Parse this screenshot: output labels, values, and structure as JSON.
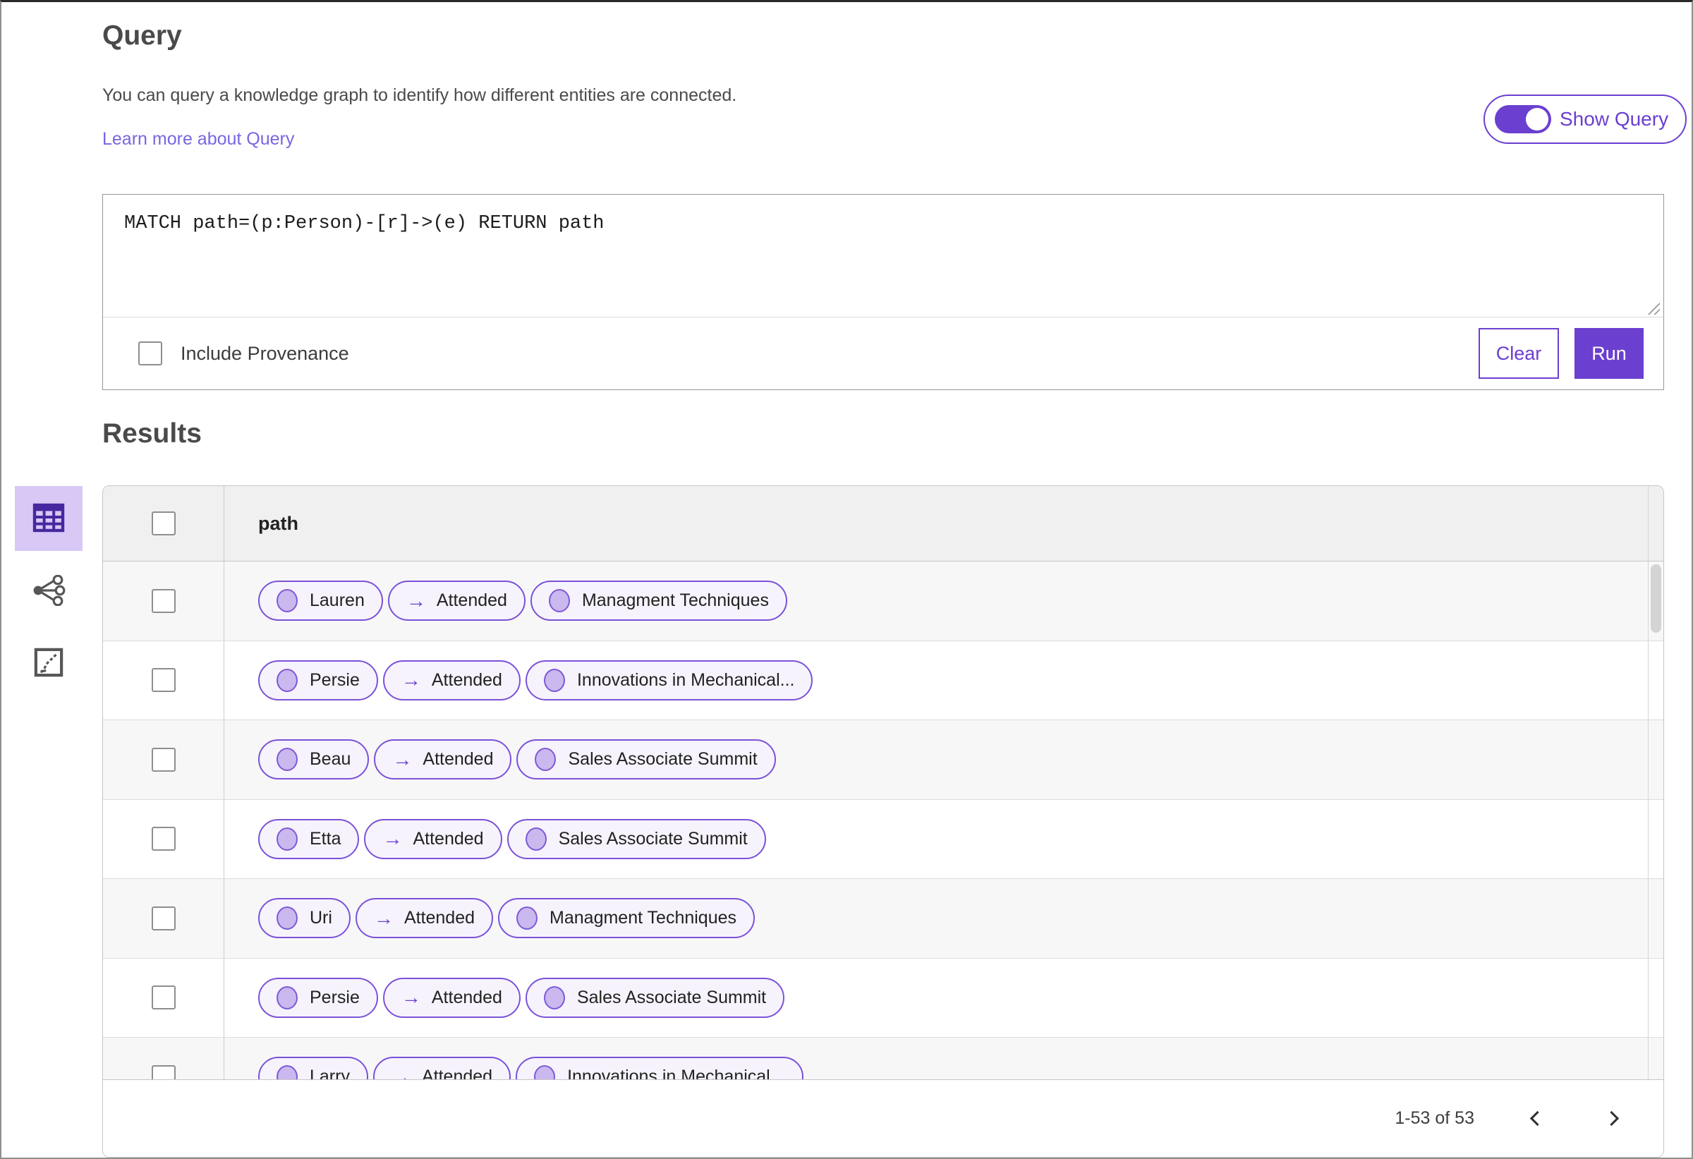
{
  "header": {
    "title": "Query",
    "description": "You can query a knowledge graph to identify how different entities are connected.",
    "learn_more_link": "Learn more about Query",
    "show_query_toggle": {
      "label": "Show Query",
      "state": "on"
    }
  },
  "query_editor": {
    "query_text": "MATCH path=(p:Person)-[r]->(e) RETURN path",
    "include_provenance": {
      "label": "Include Provenance",
      "checked": false
    },
    "clear_button": "Clear",
    "run_button": "Run"
  },
  "results": {
    "heading": "Results",
    "view_switcher": [
      {
        "name": "table-view-icon",
        "selected": true
      },
      {
        "name": "graph-view-icon",
        "selected": false
      },
      {
        "name": "chart-view-icon",
        "selected": false
      }
    ],
    "table": {
      "column_header": "path",
      "edge_arrow": "→",
      "rows": [
        {
          "source": "Lauren",
          "edge": "Attended",
          "target": "Managment Techniques"
        },
        {
          "source": "Persie",
          "edge": "Attended",
          "target": "Innovations in Mechanical..."
        },
        {
          "source": "Beau",
          "edge": "Attended",
          "target": "Sales Associate Summit"
        },
        {
          "source": "Etta",
          "edge": "Attended",
          "target": "Sales Associate Summit"
        },
        {
          "source": "Uri",
          "edge": "Attended",
          "target": "Managment Techniques"
        },
        {
          "source": "Persie",
          "edge": "Attended",
          "target": "Sales Associate Summit"
        },
        {
          "source": "Larry",
          "edge": "Attended",
          "target": "Innovations in Mechanical..."
        }
      ]
    },
    "pagination": {
      "range_label": "1-53 of 53",
      "prev_icon": "chevron-left",
      "next_icon": "chevron-right"
    }
  },
  "colors": {
    "accent_purple": "#6b3fd0",
    "pill_border": "#7b52d8",
    "pill_background": "#f6f3fd",
    "node_circle_fill": "#cab8ee",
    "selected_view_background": "#d8c8f6",
    "table_header_background": "#f0f0f1",
    "alt_row_background": "#f7f7f8",
    "link_color": "#7766e2"
  }
}
